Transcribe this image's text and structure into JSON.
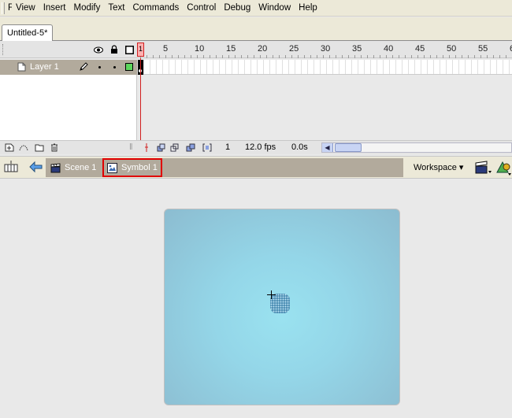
{
  "menu": {
    "items": [
      "File",
      "View",
      "Insert",
      "Modify",
      "Text",
      "Commands",
      "Control",
      "Debug",
      "Window",
      "Help"
    ]
  },
  "document": {
    "tab_label": "Untitled-5*"
  },
  "timeline": {
    "ruler_numbers": [
      "1",
      "5",
      "10",
      "15",
      "20",
      "25",
      "30",
      "35",
      "40",
      "45",
      "50",
      "55",
      "6"
    ],
    "playhead_label": "1",
    "layer": {
      "name": "Layer 1",
      "color": "#5cd65c"
    },
    "footer": {
      "current_frame": "1",
      "frame_rate": "12.0 fps",
      "elapsed_time": "0.0s"
    }
  },
  "editbar": {
    "scene_label": "Scene 1",
    "symbol_label": "Symbol 1",
    "workspace_label": "Workspace"
  },
  "colors": {
    "accent_red": "#e00000",
    "layer_row_bg": "#b2aa9c",
    "stage_center": "#9ae2f0",
    "stage_edge": "#8cbcd0"
  }
}
